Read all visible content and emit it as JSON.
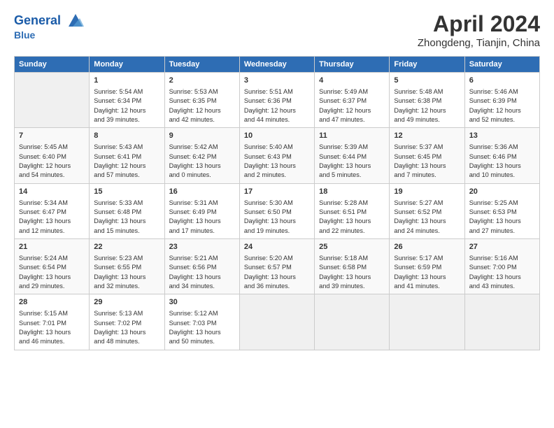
{
  "header": {
    "logo_line1": "General",
    "logo_line2": "Blue",
    "title": "April 2024",
    "location": "Zhongdeng, Tianjin, China"
  },
  "columns": [
    "Sunday",
    "Monday",
    "Tuesday",
    "Wednesday",
    "Thursday",
    "Friday",
    "Saturday"
  ],
  "weeks": [
    [
      {
        "day": "",
        "content": ""
      },
      {
        "day": "1",
        "content": "Sunrise: 5:54 AM\nSunset: 6:34 PM\nDaylight: 12 hours\nand 39 minutes."
      },
      {
        "day": "2",
        "content": "Sunrise: 5:53 AM\nSunset: 6:35 PM\nDaylight: 12 hours\nand 42 minutes."
      },
      {
        "day": "3",
        "content": "Sunrise: 5:51 AM\nSunset: 6:36 PM\nDaylight: 12 hours\nand 44 minutes."
      },
      {
        "day": "4",
        "content": "Sunrise: 5:49 AM\nSunset: 6:37 PM\nDaylight: 12 hours\nand 47 minutes."
      },
      {
        "day": "5",
        "content": "Sunrise: 5:48 AM\nSunset: 6:38 PM\nDaylight: 12 hours\nand 49 minutes."
      },
      {
        "day": "6",
        "content": "Sunrise: 5:46 AM\nSunset: 6:39 PM\nDaylight: 12 hours\nand 52 minutes."
      }
    ],
    [
      {
        "day": "7",
        "content": "Sunrise: 5:45 AM\nSunset: 6:40 PM\nDaylight: 12 hours\nand 54 minutes."
      },
      {
        "day": "8",
        "content": "Sunrise: 5:43 AM\nSunset: 6:41 PM\nDaylight: 12 hours\nand 57 minutes."
      },
      {
        "day": "9",
        "content": "Sunrise: 5:42 AM\nSunset: 6:42 PM\nDaylight: 13 hours\nand 0 minutes."
      },
      {
        "day": "10",
        "content": "Sunrise: 5:40 AM\nSunset: 6:43 PM\nDaylight: 13 hours\nand 2 minutes."
      },
      {
        "day": "11",
        "content": "Sunrise: 5:39 AM\nSunset: 6:44 PM\nDaylight: 13 hours\nand 5 minutes."
      },
      {
        "day": "12",
        "content": "Sunrise: 5:37 AM\nSunset: 6:45 PM\nDaylight: 13 hours\nand 7 minutes."
      },
      {
        "day": "13",
        "content": "Sunrise: 5:36 AM\nSunset: 6:46 PM\nDaylight: 13 hours\nand 10 minutes."
      }
    ],
    [
      {
        "day": "14",
        "content": "Sunrise: 5:34 AM\nSunset: 6:47 PM\nDaylight: 13 hours\nand 12 minutes."
      },
      {
        "day": "15",
        "content": "Sunrise: 5:33 AM\nSunset: 6:48 PM\nDaylight: 13 hours\nand 15 minutes."
      },
      {
        "day": "16",
        "content": "Sunrise: 5:31 AM\nSunset: 6:49 PM\nDaylight: 13 hours\nand 17 minutes."
      },
      {
        "day": "17",
        "content": "Sunrise: 5:30 AM\nSunset: 6:50 PM\nDaylight: 13 hours\nand 19 minutes."
      },
      {
        "day": "18",
        "content": "Sunrise: 5:28 AM\nSunset: 6:51 PM\nDaylight: 13 hours\nand 22 minutes."
      },
      {
        "day": "19",
        "content": "Sunrise: 5:27 AM\nSunset: 6:52 PM\nDaylight: 13 hours\nand 24 minutes."
      },
      {
        "day": "20",
        "content": "Sunrise: 5:25 AM\nSunset: 6:53 PM\nDaylight: 13 hours\nand 27 minutes."
      }
    ],
    [
      {
        "day": "21",
        "content": "Sunrise: 5:24 AM\nSunset: 6:54 PM\nDaylight: 13 hours\nand 29 minutes."
      },
      {
        "day": "22",
        "content": "Sunrise: 5:23 AM\nSunset: 6:55 PM\nDaylight: 13 hours\nand 32 minutes."
      },
      {
        "day": "23",
        "content": "Sunrise: 5:21 AM\nSunset: 6:56 PM\nDaylight: 13 hours\nand 34 minutes."
      },
      {
        "day": "24",
        "content": "Sunrise: 5:20 AM\nSunset: 6:57 PM\nDaylight: 13 hours\nand 36 minutes."
      },
      {
        "day": "25",
        "content": "Sunrise: 5:18 AM\nSunset: 6:58 PM\nDaylight: 13 hours\nand 39 minutes."
      },
      {
        "day": "26",
        "content": "Sunrise: 5:17 AM\nSunset: 6:59 PM\nDaylight: 13 hours\nand 41 minutes."
      },
      {
        "day": "27",
        "content": "Sunrise: 5:16 AM\nSunset: 7:00 PM\nDaylight: 13 hours\nand 43 minutes."
      }
    ],
    [
      {
        "day": "28",
        "content": "Sunrise: 5:15 AM\nSunset: 7:01 PM\nDaylight: 13 hours\nand 46 minutes."
      },
      {
        "day": "29",
        "content": "Sunrise: 5:13 AM\nSunset: 7:02 PM\nDaylight: 13 hours\nand 48 minutes."
      },
      {
        "day": "30",
        "content": "Sunrise: 5:12 AM\nSunset: 7:03 PM\nDaylight: 13 hours\nand 50 minutes."
      },
      {
        "day": "",
        "content": ""
      },
      {
        "day": "",
        "content": ""
      },
      {
        "day": "",
        "content": ""
      },
      {
        "day": "",
        "content": ""
      }
    ]
  ]
}
